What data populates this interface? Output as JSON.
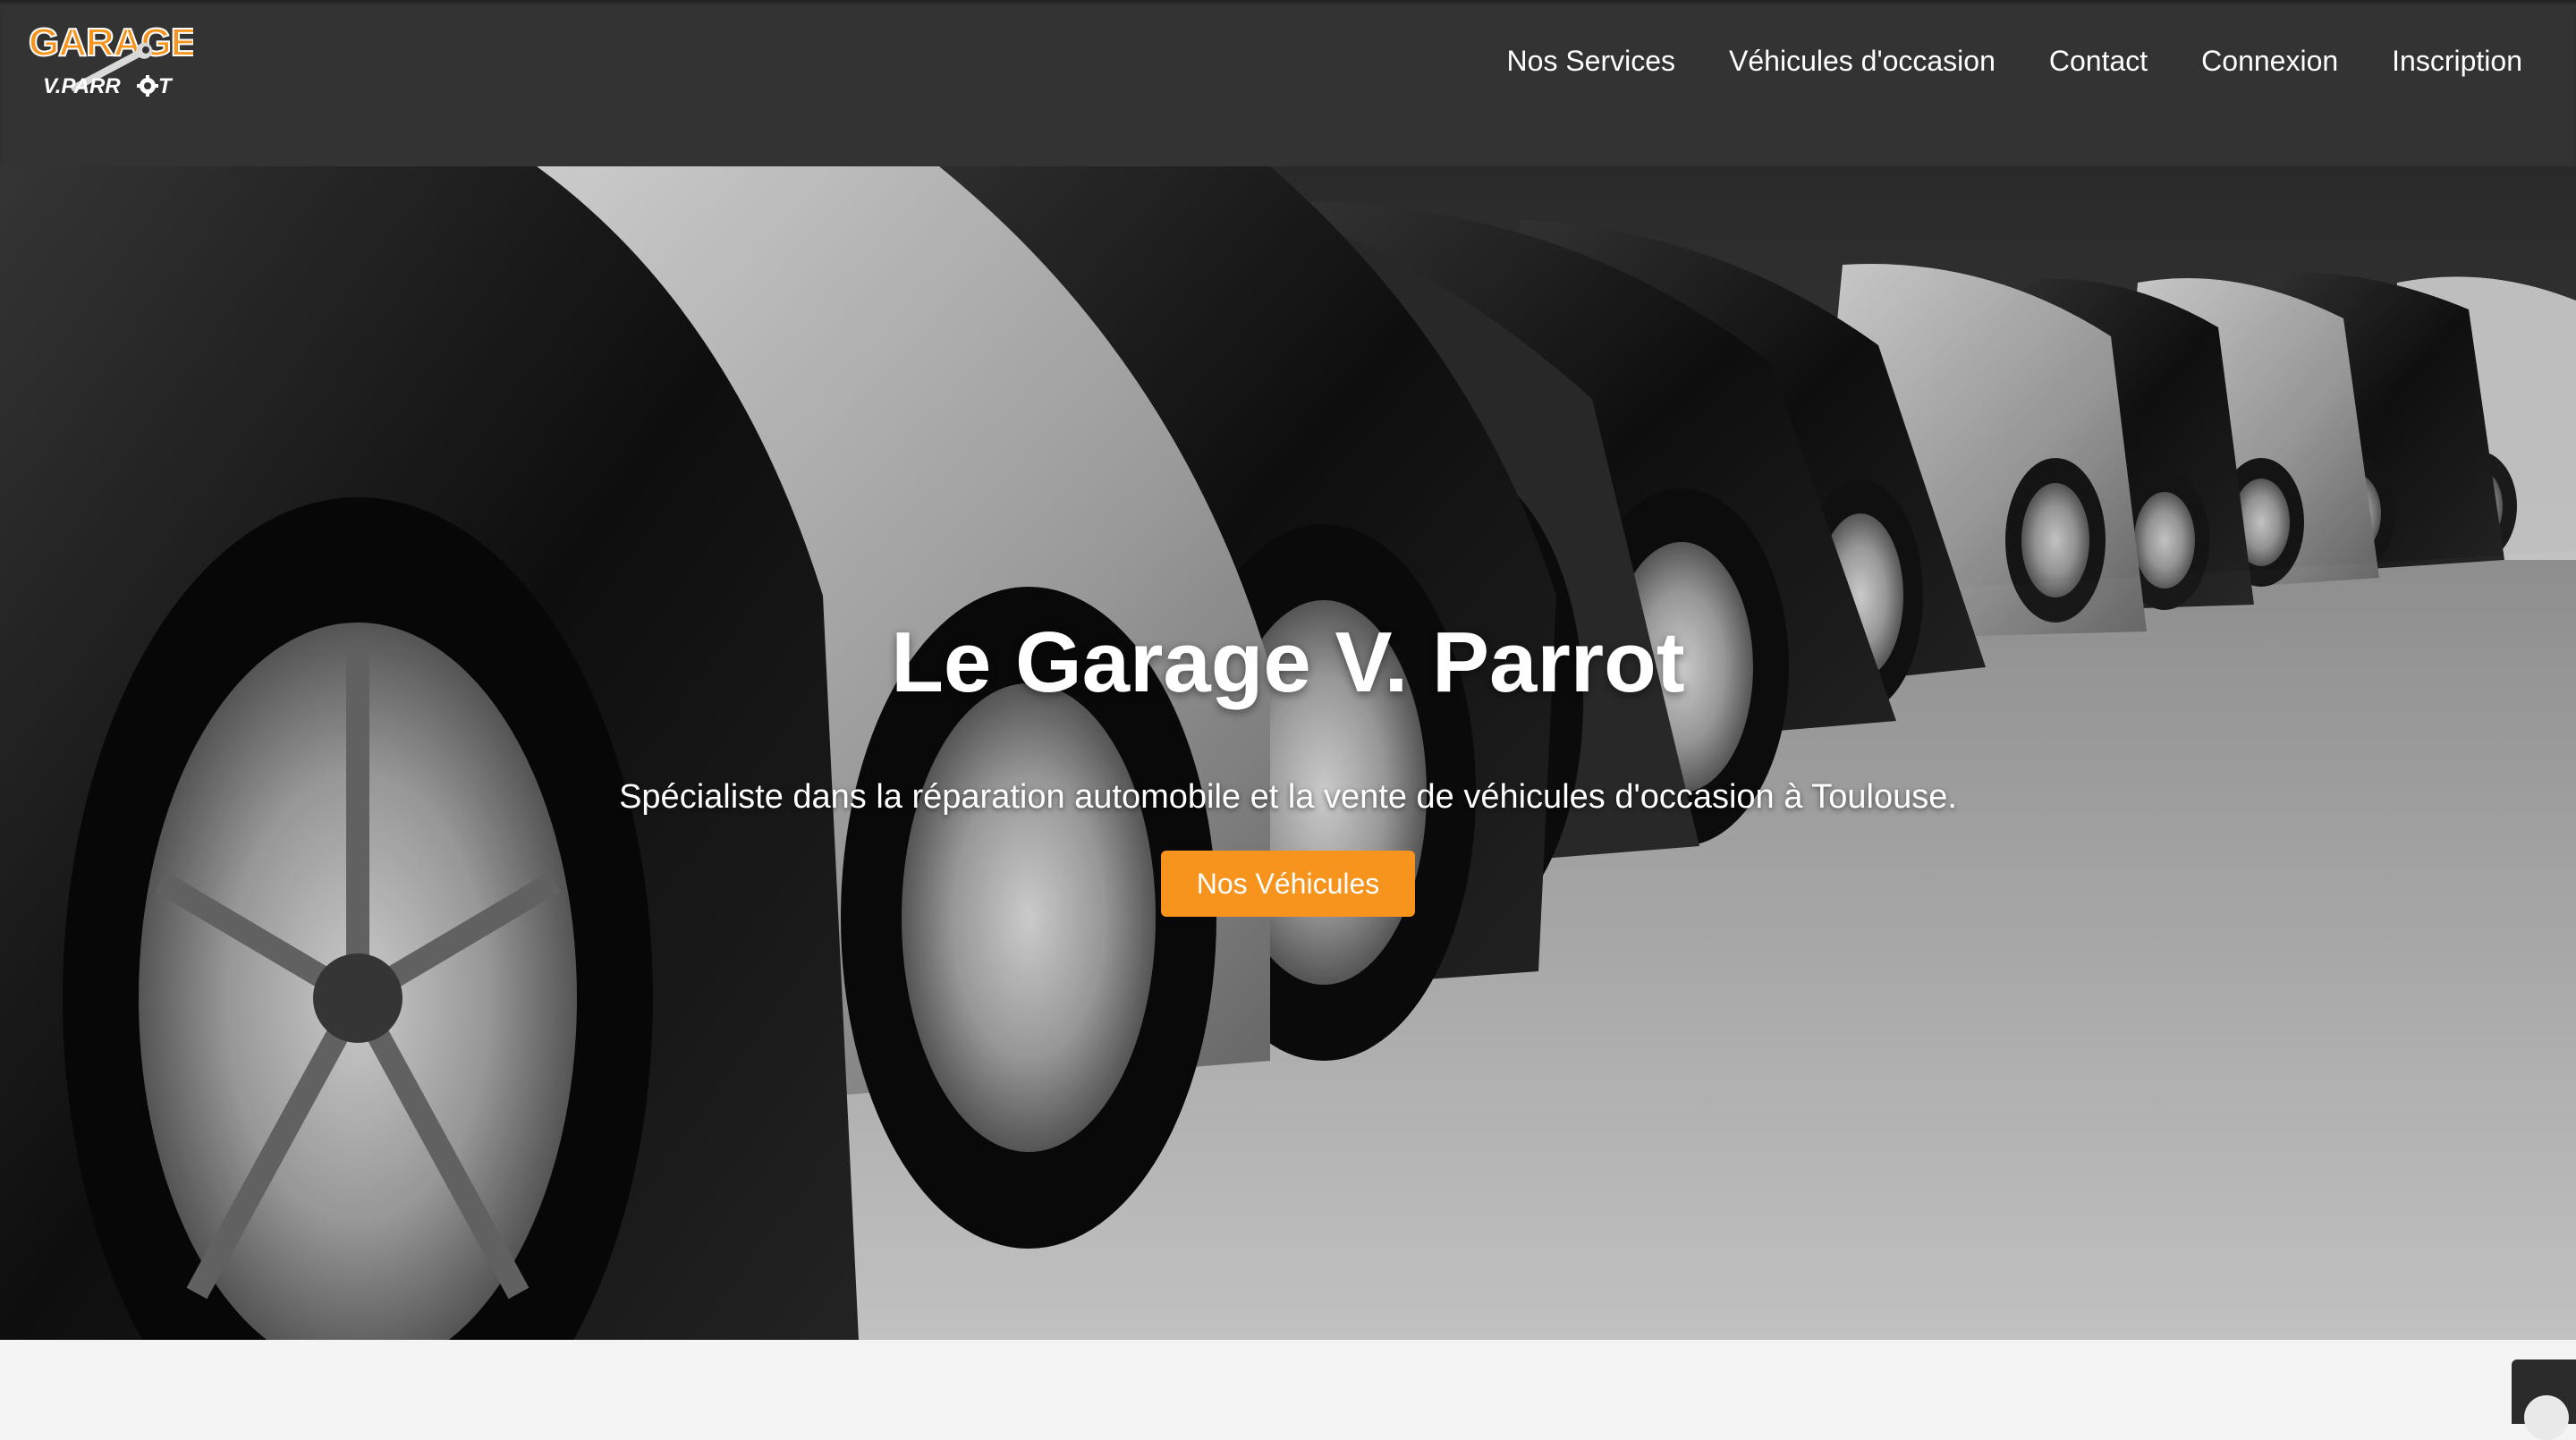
{
  "logo": {
    "alt": "Garage V. Parrot",
    "line1": "GARAGE",
    "line2": "V. PARROT",
    "icon": "wrench-gear-logo-icon",
    "colors": {
      "orange": "#f7941d",
      "white": "#ffffff"
    }
  },
  "nav": {
    "items": [
      {
        "label": "Nos Services"
      },
      {
        "label": "Véhicules d'occasion"
      },
      {
        "label": "Contact"
      },
      {
        "label": "Connexion"
      },
      {
        "label": "Inscription"
      }
    ]
  },
  "hero": {
    "background": "black-and-white photo of a row of parked cars",
    "title": "Le Garage V. Parrot",
    "subtitle": "Spécialiste dans la réparation automobile et la vente de véhicules d'occasion à Toulouse.",
    "cta_label": "Nos Véhicules"
  },
  "colors": {
    "navbar_bg": "#333333",
    "accent": "#f7941d",
    "page_bg": "#f4f4f4"
  },
  "corner_widget": {
    "icon": "chat-widget-icon"
  }
}
